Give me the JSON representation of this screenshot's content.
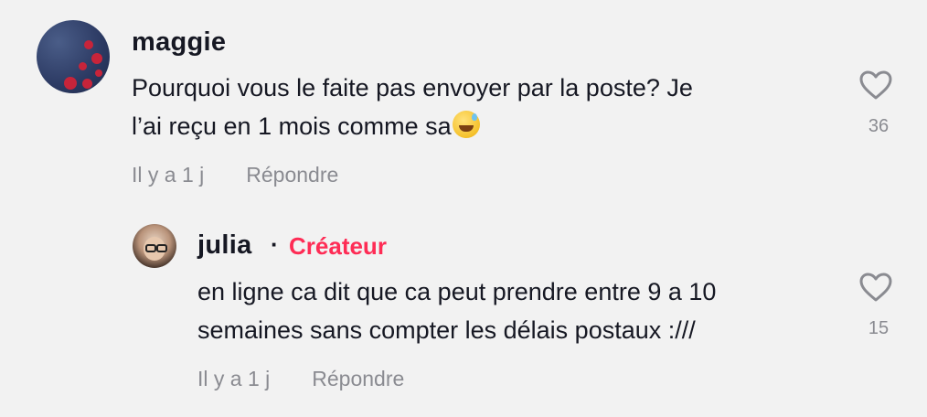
{
  "comments": [
    {
      "username": "maggie",
      "text_line1": "Pourquoi vous le faite pas envoyer par la poste? Je",
      "text_line2": "l’ai reçu en 1 mois comme sa",
      "emoji_icon": "grinning-face-with-sweat-emoji",
      "timestamp": "Il y a 1 j",
      "reply_label": "Répondre",
      "likes": "36"
    }
  ],
  "replies": [
    {
      "username": "julia",
      "separator": "·",
      "creator_badge": "Créateur",
      "text_line1": "en ligne ca dit que ca peut prendre entre 9 a 10",
      "text_line2": "semaines sans compter les délais postaux :///",
      "timestamp": "Il y a 1 j",
      "reply_label": "Répondre",
      "likes": "15"
    }
  ],
  "colors": {
    "creator": "#fe2c55",
    "muted": "#8a8b91",
    "text": "#161823"
  }
}
